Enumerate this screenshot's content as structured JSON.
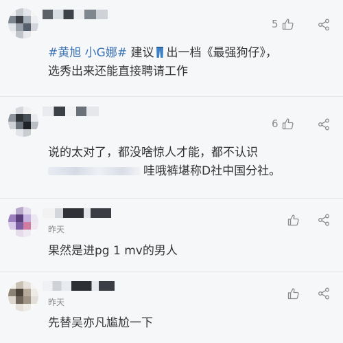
{
  "comments": [
    {
      "likes": "5",
      "text": {
        "hashtag": "#黄旭 小G娜#",
        "before_icon": " 建议",
        "after_icon": "出一档《最强狗仔》，",
        "line2": "选秀出来还能直接聘请工作"
      }
    },
    {
      "likes": "6",
      "text": {
        "line1": "说的太对了，都没啥惊人才能，都不认识",
        "line2": "哇哦裤堪称D社中国分社。"
      }
    },
    {
      "time": "昨天",
      "likes": "",
      "text": {
        "line1": "果然是进pg 1 mv的男人"
      }
    },
    {
      "time": "昨天",
      "likes": "",
      "text": {
        "line1": "先替吴亦凡尴尬一下"
      }
    }
  ],
  "icons": {
    "like": "thumbs-up-outline",
    "share": "share-nodes",
    "inline": "jeans-emoji"
  },
  "colors": {
    "background": "#f6f7f9",
    "hashtag": "#3b72b4",
    "meta": "#8a8a8a",
    "text": "#333333",
    "divider": "#e6e6e6"
  }
}
